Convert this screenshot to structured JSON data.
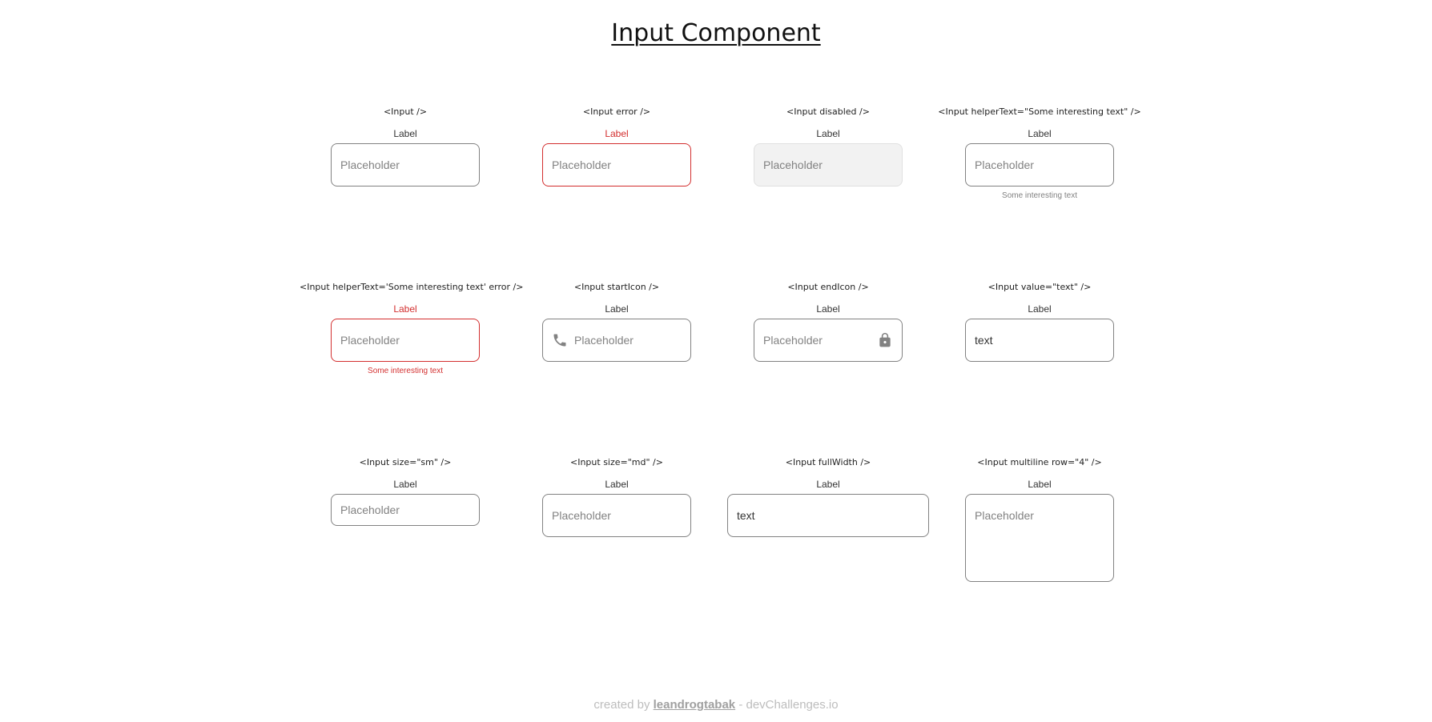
{
  "page": {
    "title": "Input Component"
  },
  "demos": [
    {
      "code": "<Input />",
      "label": "Label",
      "placeholder": "Placeholder"
    },
    {
      "code": "<Input error />",
      "label": "Label",
      "placeholder": "Placeholder"
    },
    {
      "code": "<Input disabled />",
      "label": "Label",
      "placeholder": "Placeholder"
    },
    {
      "code": "<Input helperText=\"Some interesting text\" />",
      "label": "Label",
      "placeholder": "Placeholder",
      "helper": "Some interesting text"
    },
    {
      "code": "<Input helperText='Some interesting text' error />",
      "label": "Label",
      "placeholder": "Placeholder",
      "helper": "Some interesting text"
    },
    {
      "code": "<Input startIcon />",
      "label": "Label",
      "placeholder": "Placeholder",
      "icon": "phone-icon"
    },
    {
      "code": "<Input endIcon />",
      "label": "Label",
      "placeholder": "Placeholder",
      "icon": "lock-icon"
    },
    {
      "code": "<Input value=\"text\" />",
      "label": "Label",
      "value": "text"
    },
    {
      "code": "<Input size=\"sm\" />",
      "label": "Label",
      "placeholder": "Placeholder"
    },
    {
      "code": "<Input size=\"md\" />",
      "label": "Label",
      "placeholder": "Placeholder"
    },
    {
      "code": "<Input fullWidth />",
      "label": "Label",
      "value": "text"
    },
    {
      "code": "<Input multiline row=\"4\" />",
      "label": "Label",
      "placeholder": "Placeholder"
    }
  ],
  "footer": {
    "prefix": "created by",
    "author": "leandrogtabak",
    "suffix": "- devChallenges.io"
  },
  "colors": {
    "error": "#D32F2F",
    "border": "#828282",
    "disabled_bg": "#F2F2F2",
    "icon": "#828282"
  }
}
